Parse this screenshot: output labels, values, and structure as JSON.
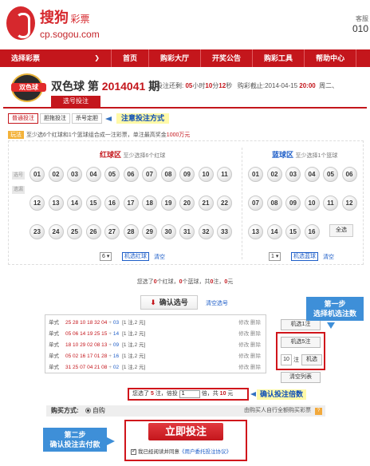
{
  "header": {
    "logo_title": "搜狗",
    "logo_sub": "彩票",
    "logo_url": "cp.sogou.com",
    "right_line1": "客服",
    "right_line2": "010"
  },
  "nav": {
    "items": [
      {
        "label": "选择彩票"
      },
      {
        "label": "首页"
      },
      {
        "label": "购彩大厅"
      },
      {
        "label": "开奖公告"
      },
      {
        "label": "购彩工具"
      },
      {
        "label": "帮助中心"
      }
    ]
  },
  "game": {
    "badge": "双色球",
    "name": "双色球 第",
    "issue": "2014041",
    "issue_suffix": "期",
    "countdown_prefix": "投注还剩:",
    "hours": "05",
    "hours_unit": "小时",
    "minutes": "10",
    "minutes_unit": "分",
    "seconds": "12",
    "seconds_unit": "秒",
    "deadline_label": "购彩截止:",
    "deadline_date": "2014-04-15",
    "deadline_time": "20:00",
    "deadline_day": "周二、",
    "main_tab": "选号投注"
  },
  "subtabs": [
    {
      "label": "普通投注",
      "active": true
    },
    {
      "label": "胆拖投注",
      "active": false
    },
    {
      "label": "杀号定胆",
      "active": false
    }
  ],
  "annotation_mode": "注意投注方式",
  "rule": {
    "tag": "玩法",
    "text": "至少选6个红球和1个篮球组合成一注彩票，单注最高奖金",
    "amount": "1000万元"
  },
  "zones": {
    "red_title": "红球区",
    "red_sub": "至少选择6个红球",
    "blue_title": "蓝球区",
    "blue_sub": "至少选择1个篮球",
    "row_label_1": "选号",
    "row_label_2": "遗漏"
  },
  "red_balls": [
    "01",
    "02",
    "03",
    "04",
    "05",
    "06",
    "07",
    "08",
    "09",
    "10",
    "11",
    "12",
    "13",
    "14",
    "15",
    "16",
    "17",
    "18",
    "19",
    "20",
    "21",
    "22",
    "23",
    "24",
    "25",
    "26",
    "27",
    "28",
    "29",
    "30",
    "31",
    "32",
    "33"
  ],
  "blue_balls": [
    "01",
    "02",
    "03",
    "04",
    "05",
    "06",
    "07",
    "08",
    "09",
    "10",
    "11",
    "12",
    "13",
    "14",
    "15",
    "16"
  ],
  "machine_select_label": "全选",
  "red_random": {
    "count": "6",
    "button": "机选红球",
    "clear": "清空"
  },
  "blue_random": {
    "count": "1",
    "button": "机选蓝球",
    "clear": "清空"
  },
  "summary": {
    "prefix": "您选了",
    "red_count": "0",
    "mid1": "个红球，",
    "blue_count": "0",
    "mid2": "个蓝球，共",
    "bets": "0",
    "mid3": "注，",
    "amount": "0",
    "suffix": "元"
  },
  "confirm_button": "确认选号",
  "clear_select": "清空选号",
  "bets": [
    {
      "type": "单式",
      "reds": "25 28 10 18 32 04",
      "blue": "03",
      "count": "[1 注,2 元]",
      "ops": "修改 删除"
    },
    {
      "type": "单式",
      "reds": "05 06 14 19 25 15",
      "blue": "14",
      "count": "[1 注,2 元]",
      "ops": "修改 删除"
    },
    {
      "type": "单式",
      "reds": "18 10 29 02 08 13",
      "blue": "09",
      "count": "[1 注,2 元]",
      "ops": "修改 删除"
    },
    {
      "type": "单式",
      "reds": "05 02 16 17 01 28",
      "blue": "16",
      "count": "[1 注,2 元]",
      "ops": "修改 删除"
    },
    {
      "type": "单式",
      "reds": "31 25 07 04 21 08",
      "blue": "02",
      "count": "[1 注,2 元]",
      "ops": "修改 删除"
    }
  ],
  "side": {
    "random1": "机选1注",
    "random5": "机选5注",
    "custom_count": "10",
    "custom_unit": "注",
    "custom_button": "机选",
    "clear_list": "清空列表"
  },
  "step1": {
    "line1": "第一步",
    "line2": "选择机选注数"
  },
  "multiplier": {
    "prefix": "您选了",
    "bets": "5",
    "mid": "注，倍投",
    "value": "1",
    "mid2": "倍，共",
    "amount": "10",
    "suffix": "元"
  },
  "annotation_multi": "确认投注倍数",
  "buy": {
    "label": "购买方式:",
    "option": "自购",
    "right_text": "由购买人自行全额购买彩票",
    "help": "?"
  },
  "step2": {
    "line1": "第二步",
    "line2": "确认投注去付款"
  },
  "submit_button": "立即投注",
  "agree": {
    "text": "我已经阅读并同意",
    "link": "《用户委托投注协议》"
  },
  "colors": {
    "brand_red": "#c4161c",
    "blue": "#1e5ec8",
    "annotation_blue": "#3e8fd8",
    "highlight_yellow": "#fff9a8"
  }
}
